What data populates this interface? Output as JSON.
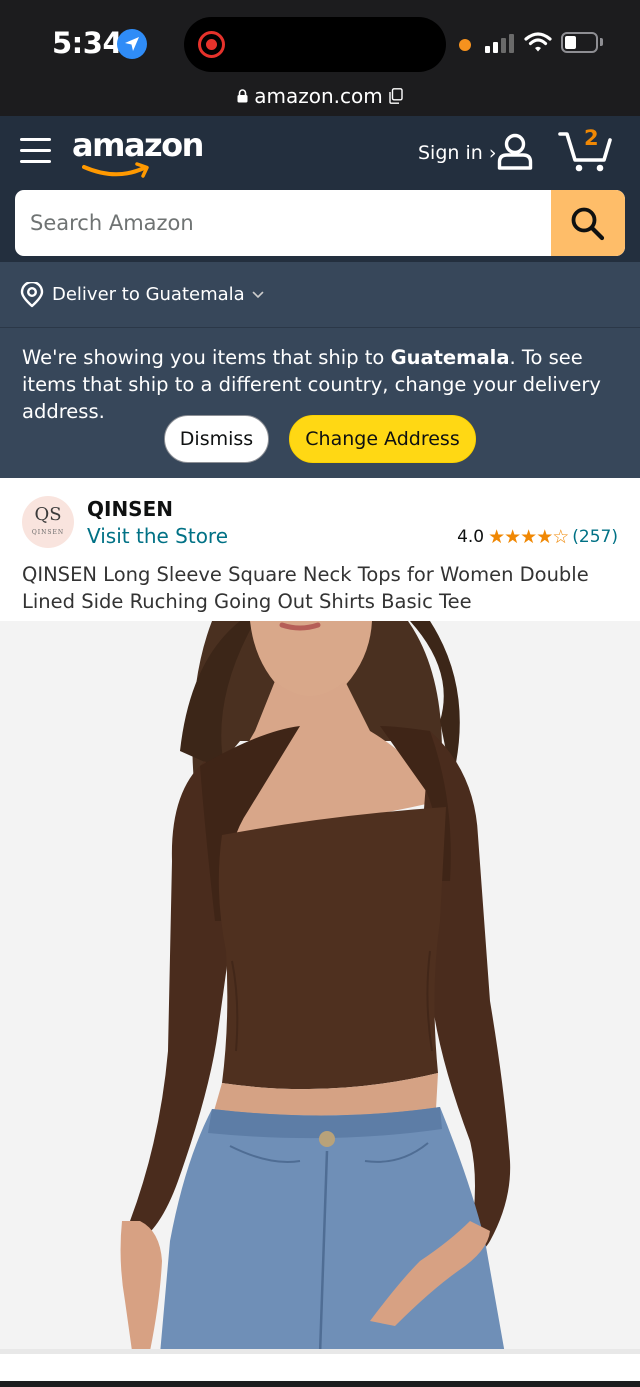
{
  "status_bar": {
    "time": "5:34",
    "icons": [
      "location-arrow-icon",
      "screen-recording-icon",
      "cellular-signal-icon",
      "wifi-icon",
      "battery-icon"
    ]
  },
  "browser": {
    "url": "amazon.com",
    "icons": [
      "lock-icon",
      "copy-icon"
    ]
  },
  "header": {
    "logo_text": "amazon",
    "sign_in_label": "Sign in ›",
    "cart_count": "2",
    "search_placeholder": "Search Amazon",
    "icons": [
      "menu-icon",
      "user-icon",
      "cart-icon",
      "search-icon"
    ]
  },
  "delivery": {
    "label": "Deliver to Guatemala",
    "icons": [
      "location-pin-icon",
      "chevron-down-icon"
    ]
  },
  "notice": {
    "text_before": "We're showing you items that ship to ",
    "country": "Guatemala",
    "text_after": ". To see items that ship to a different country, change your delivery address.",
    "dismiss_label": "Dismiss",
    "change_label": "Change Address"
  },
  "product": {
    "store_logo_mark": "QS",
    "store_logo_word": "QINSEN",
    "brand": "QINSEN",
    "visit_store_label": "Visit the Store",
    "rating_value": "4.0",
    "rating_stars": "★★★★☆",
    "rating_numeric": 4.0,
    "rating_count": "(257)",
    "title": "QINSEN Long Sleeve Square Neck Tops for Women Double Lined Side Ruching Going Out Shirts Basic Tee"
  },
  "colors": {
    "nav_bg": "#232f3e",
    "subnav_bg": "#37475a",
    "search_button": "#febd69",
    "change_button": "#ffd814",
    "link": "#007185",
    "star": "#f08804",
    "product_garment": "#4a2c1d"
  }
}
